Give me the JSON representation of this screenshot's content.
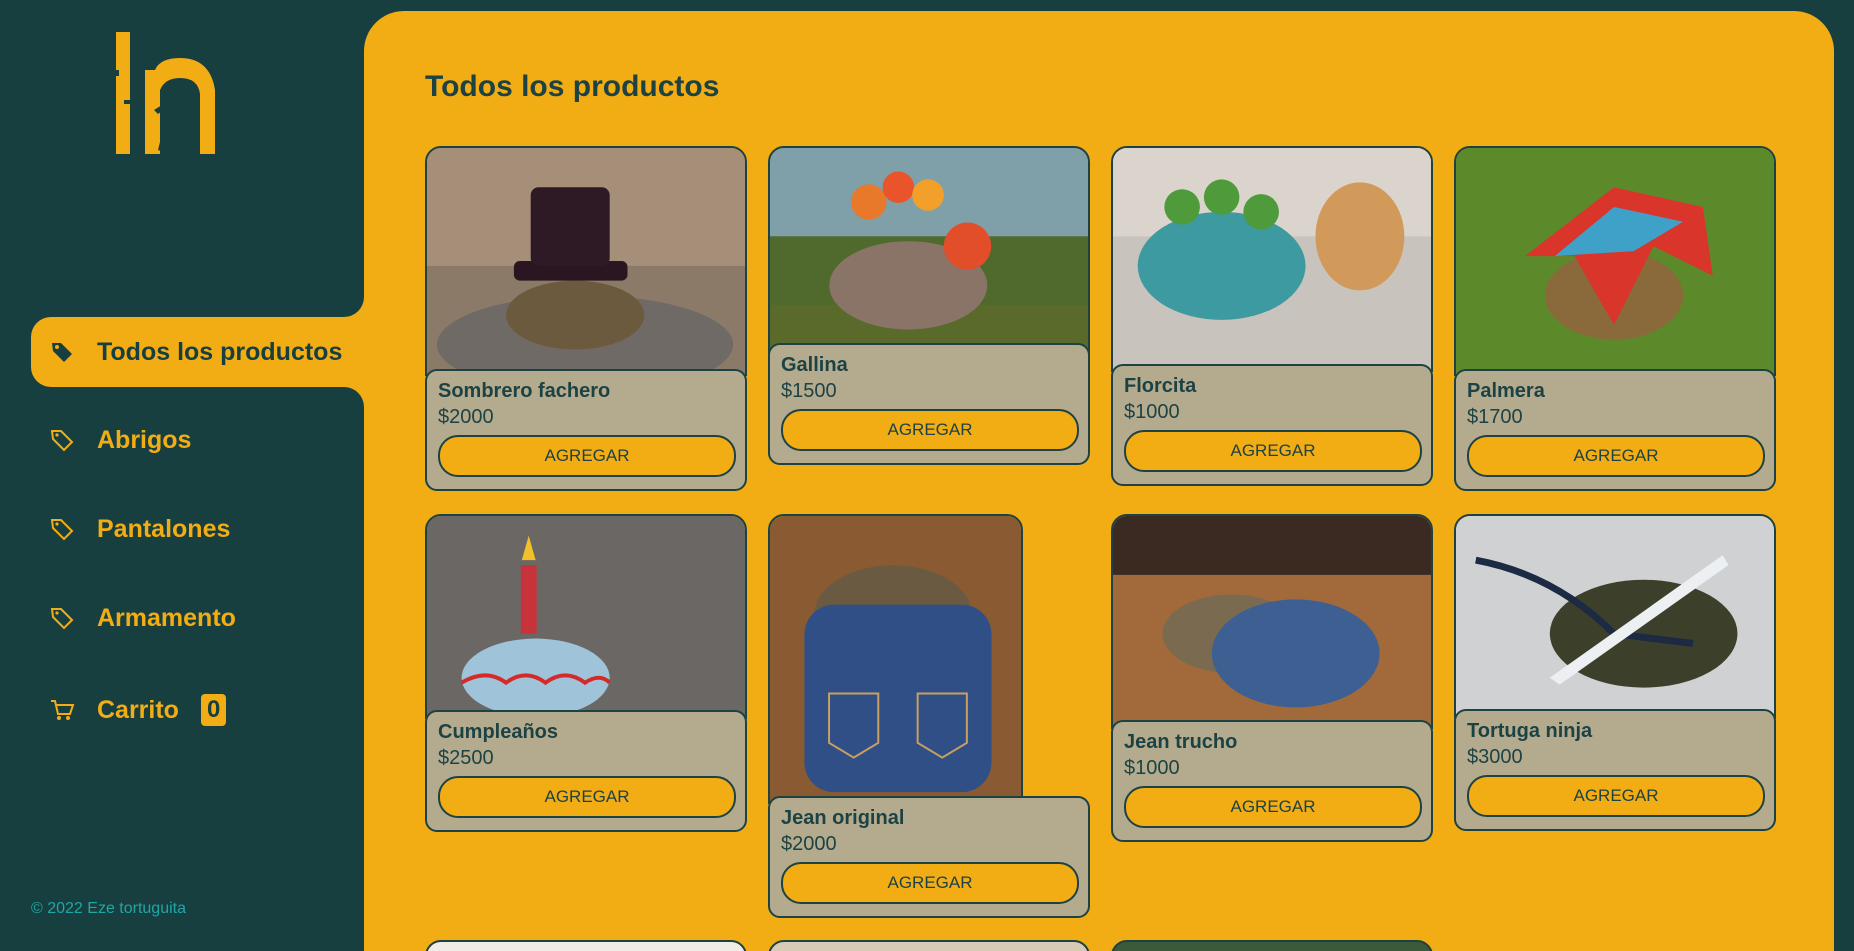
{
  "sidebar": {
    "logo_alt": "logo",
    "nav": [
      {
        "label": "Todos los productos",
        "icon": "tag-icon"
      },
      {
        "label": "Abrigos",
        "icon": "tag-outline-icon"
      },
      {
        "label": "Pantalones",
        "icon": "tag-outline-icon"
      },
      {
        "label": "Armamento",
        "icon": "tag-outline-icon"
      },
      {
        "label": "Carrito",
        "icon": "cart-icon",
        "badge": "0"
      }
    ],
    "footer": "© 2022 Eze tortuguita"
  },
  "main": {
    "title": "Todos los productos",
    "button_label": "AGREGAR",
    "products": [
      {
        "name": "Sombrero fachero",
        "price": "$2000"
      },
      {
        "name": "Gallina",
        "price": "$1500"
      },
      {
        "name": "Florcita",
        "price": "$1000"
      },
      {
        "name": "Palmera",
        "price": "$1700"
      },
      {
        "name": "Cumpleaños",
        "price": "$2500"
      },
      {
        "name": "Jean original",
        "price": "$2000"
      },
      {
        "name": "Jean trucho",
        "price": "$1000"
      },
      {
        "name": "Tortuga ninja",
        "price": "$3000"
      }
    ]
  },
  "colors": {
    "sidebar_bg": "#173f40",
    "accent": "#f3ad14",
    "card_body": "#b4ab8f",
    "dark_text": "#1d4244",
    "footer_text": "#1fa7a5"
  }
}
